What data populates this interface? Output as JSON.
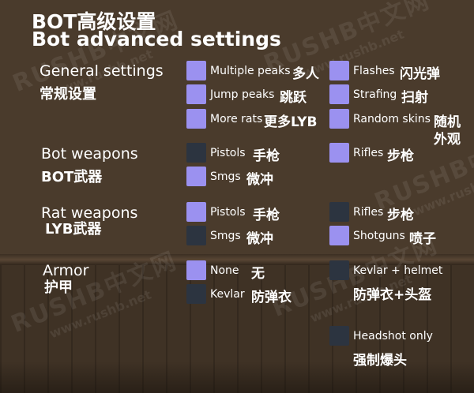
{
  "title": {
    "zh": "BOT高级设置",
    "en": "Bot advanced settings"
  },
  "watermark": {
    "brand": "RUSHB中文网",
    "url": "www.rushb.net"
  },
  "sections": {
    "general": {
      "en": "General settings",
      "zh": "常规设置"
    },
    "bot_weapons": {
      "en": "Bot weapons",
      "zh": "BOT武器"
    },
    "rat_weapons": {
      "en": "Rat weapons",
      "zh": "LYB武器"
    },
    "armor": {
      "en": "Armor",
      "zh": "护甲"
    }
  },
  "options": {
    "multiple_peaks": {
      "en": "Multiple peaks",
      "zh": "多人",
      "checked": true
    },
    "jump_peaks": {
      "en": "Jump peaks",
      "zh": "跳跃",
      "checked": true
    },
    "more_rats": {
      "en": "More rats",
      "zh": "更多LYB",
      "checked": true
    },
    "flashes": {
      "en": "Flashes",
      "zh": "闪光弹",
      "checked": true
    },
    "strafing": {
      "en": "Strafing",
      "zh": "扫射",
      "checked": true
    },
    "random_skins": {
      "en": "Random skins",
      "zh1": "随机",
      "zh2": "外观",
      "checked": true
    },
    "bot_pistols": {
      "en": "Pistols",
      "zh": "手枪",
      "checked": false
    },
    "bot_smgs": {
      "en": "Smgs",
      "zh": "微冲",
      "checked": true
    },
    "bot_rifles": {
      "en": "Rifles",
      "zh": "步枪",
      "checked": true
    },
    "rat_pistols": {
      "en": "Pistols",
      "zh": "手枪",
      "checked": true
    },
    "rat_smgs": {
      "en": "Smgs",
      "zh": "微冲",
      "checked": false
    },
    "rat_rifles": {
      "en": "Rifles",
      "zh": "步枪",
      "checked": false
    },
    "rat_shotguns": {
      "en": "Shotguns",
      "zh": "喷子",
      "checked": true
    },
    "armor_none": {
      "en": "None",
      "zh": "无",
      "checked": true
    },
    "armor_kevlar": {
      "en": "Kevlar",
      "zh": "防弹衣",
      "checked": false
    },
    "armor_kevlar_helmet": {
      "en": "Kevlar + helmet",
      "zh": "防弹衣+头盔",
      "checked": false
    },
    "headshot_only": {
      "en": "Headshot only",
      "zh": "强制爆头",
      "checked": false
    }
  },
  "colors": {
    "checked": "#9b91f0",
    "unchecked": "#2c3440",
    "text": "#ffffff"
  }
}
